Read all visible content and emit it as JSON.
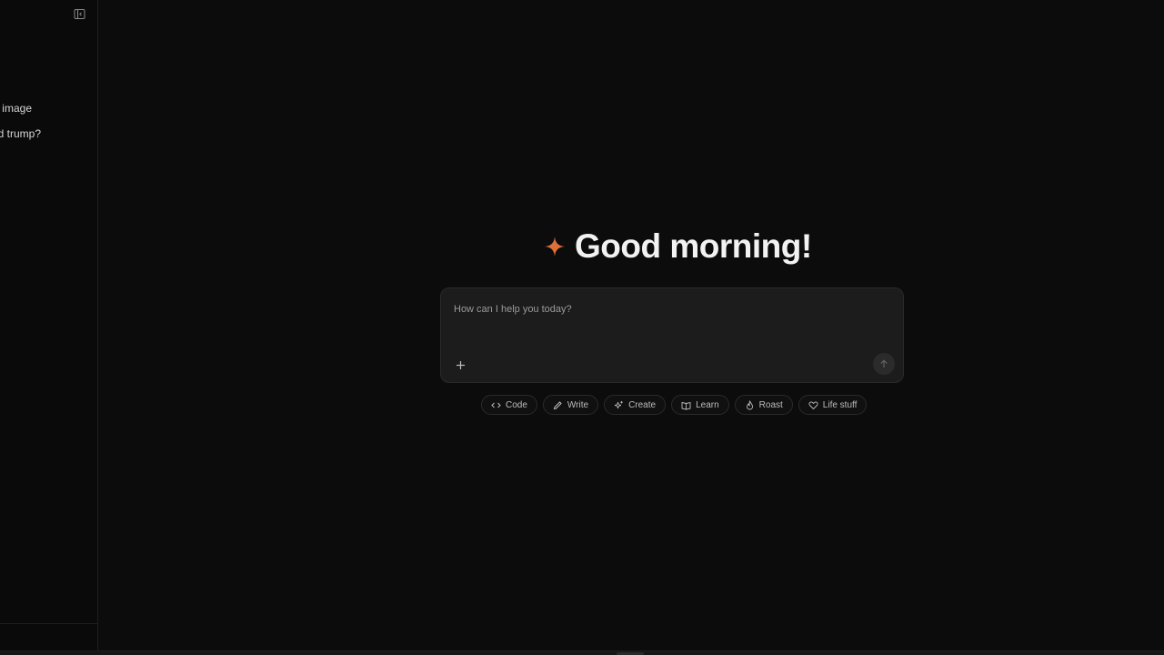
{
  "sidebar": {
    "history": [
      {
        "label": "s image"
      },
      {
        "label": "d trump?"
      }
    ]
  },
  "main": {
    "greeting": "Good morning!",
    "composer": {
      "placeholder": "How can I help you today?",
      "value": ""
    },
    "chips": [
      {
        "label": "Code",
        "icon": "code-icon"
      },
      {
        "label": "Write",
        "icon": "pen-icon"
      },
      {
        "label": "Create",
        "icon": "sparkle-icon"
      },
      {
        "label": "Learn",
        "icon": "book-icon"
      },
      {
        "label": "Roast",
        "icon": "flame-icon"
      },
      {
        "label": "Life stuff",
        "icon": "heart-icon"
      }
    ]
  },
  "colors": {
    "background": "#0c0c0c",
    "accent": "#e0703a",
    "composer": "#1c1c1c"
  }
}
